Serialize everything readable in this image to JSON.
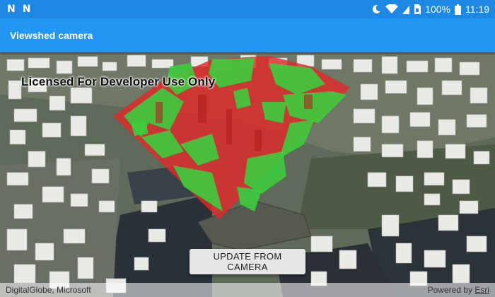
{
  "status_bar": {
    "notif_left_1": "N",
    "notif_left_2": "N",
    "battery": "100%",
    "time": "11:19",
    "icons": [
      "moon-icon",
      "wifi-icon",
      "cell-signal-icon",
      "sim-icon",
      "battery-icon"
    ]
  },
  "app_bar": {
    "title": "Viewshed camera"
  },
  "map": {
    "license_text": "Licensed For Developer Use Only",
    "update_button": "UPDATE FROM CAMERA",
    "attribution_left": "DigitalGlobe, Microsoft",
    "powered_by_prefix": "Powered by ",
    "powered_by_link": "Esri",
    "colors": {
      "visible": "#3dcc3d",
      "not_visible": "#e02a2a"
    }
  }
}
